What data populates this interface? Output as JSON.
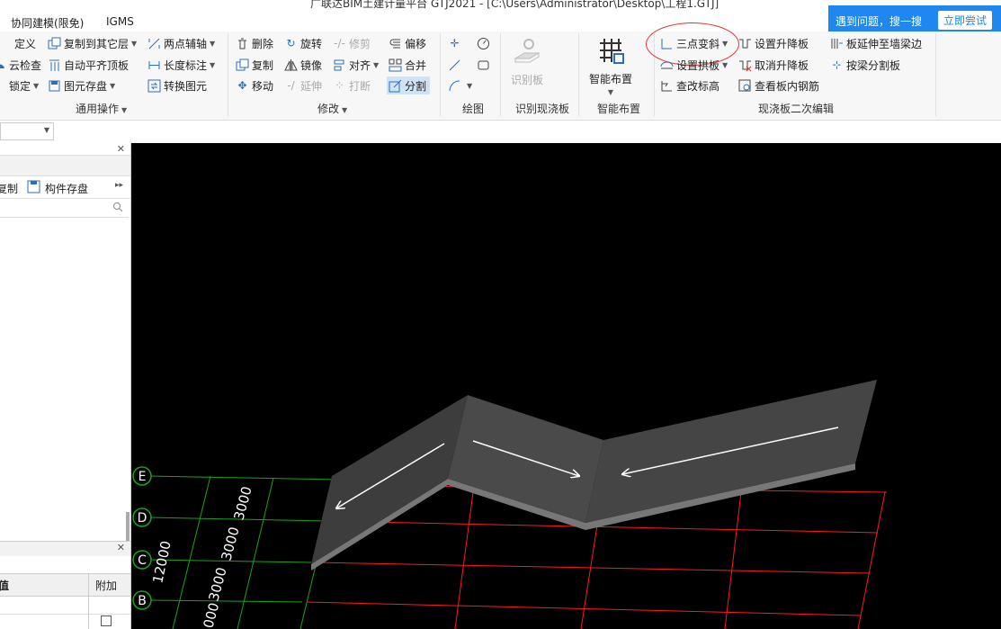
{
  "window": {
    "title": "广联达BIM土建计量平台 GTJ2021 - [C:\\Users\\Administrator\\Desktop\\工程1.GTJ]"
  },
  "menu": {
    "items": [
      "协同建模(限免)",
      "IGMS"
    ]
  },
  "notification": {
    "text": "遇到问题，搜一搜",
    "button": "立即尝试"
  },
  "ribbon": {
    "groups": {
      "general": {
        "label": "通用操作",
        "define": "定义",
        "cloud_check": "云检查",
        "lock": "锁定",
        "copy_other_floor": "复制到其它层",
        "auto_flat_top": "自动平齐顶板",
        "element_save": "图元存盘",
        "two_point_axis": "两点辅轴",
        "length_dim": "长度标注",
        "convert_element": "转换图元"
      },
      "modify": {
        "label": "修改",
        "delete": "删除",
        "rotate": "旋转",
        "trim": "修剪",
        "offset": "偏移",
        "copy": "复制",
        "mirror": "镜像",
        "align": "对齐",
        "merge": "合并",
        "move": "移动",
        "extend": "延伸",
        "break": "打断",
        "split": "分割"
      },
      "draw": {
        "label": "绘图"
      },
      "recognize": {
        "label": "识别现浇板",
        "btn": "识别板"
      },
      "smart": {
        "label": "智能布置",
        "btn": "智能布置"
      },
      "slab_edit": {
        "label": "现浇板二次编辑",
        "three_point_slope": "三点变斜",
        "set_arch": "设置拱板",
        "edit_elevation": "查改标高",
        "set_raise": "设置升降板",
        "cancel_raise": "取消升降板",
        "view_rebar": "查看板内钢筋",
        "extend_to_wall": "板延伸至墙梁边",
        "split_by_beam": "按梁分割板"
      }
    }
  },
  "left_panel": {
    "copy": "复制",
    "component_save": "构件存盘",
    "prop_header_value": "值",
    "prop_header_extra": "附加"
  },
  "canvas": {
    "axes": [
      "E",
      "D",
      "C",
      "B"
    ],
    "dimensions": [
      "3000",
      "3000",
      "3000",
      "000",
      "12000"
    ]
  },
  "colors": {
    "accent": "#1e87f0",
    "grid_green": "#1aa31a",
    "grid_red": "#ff1a1a",
    "slab": "#454545"
  }
}
